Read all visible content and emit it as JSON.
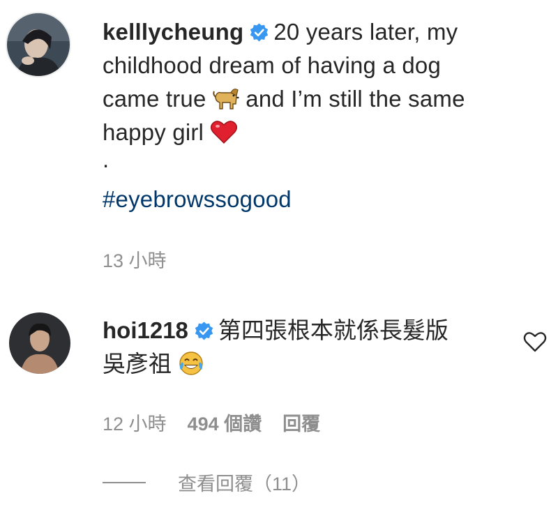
{
  "post": {
    "username": "kelllycheung",
    "caption_line1": "20 years later, my",
    "caption_line2": "childhood dream of having a dog",
    "caption_line3a": "came true",
    "caption_line3b": "and I’m still the same",
    "caption_line4": "happy girl",
    "caption_dot": ".",
    "hashtag": "#eyebrowssogood",
    "time": "13 小時",
    "dog_emoji": "dog-emoji",
    "heart_emoji": "red-heart-emoji"
  },
  "comment": {
    "username": "hoi1218",
    "text_line1": "第四張根本就係長髮版",
    "text_line2": "吳彥祖",
    "emoji": "tears-of-joy-emoji",
    "time": "12 小時",
    "likes": "494 個讚",
    "reply_label": "回覆",
    "view_replies": "查看回覆（11）"
  },
  "colors": {
    "text": "#262626",
    "secondary": "#8e8e8e",
    "hashtag": "#00376b",
    "verified": "#3897f0",
    "heart": "#e0202e"
  }
}
